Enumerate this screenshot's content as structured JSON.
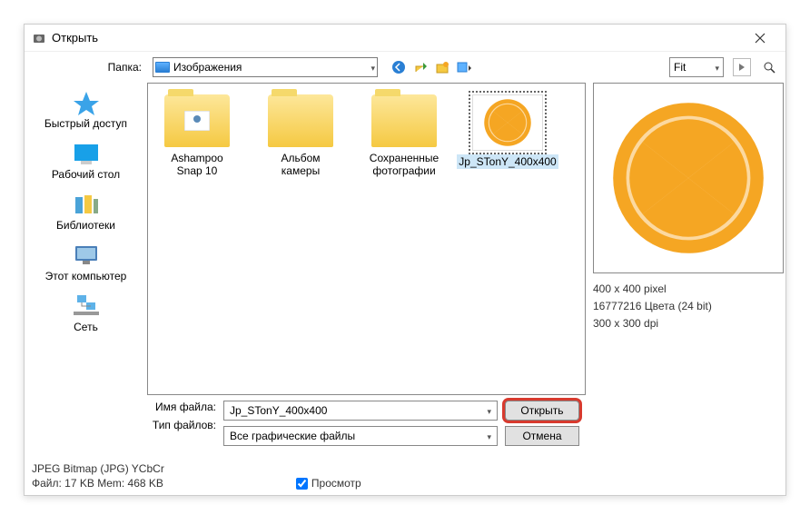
{
  "title": "Открыть",
  "folder_label": "Папка:",
  "folder_value": "Изображения",
  "fit": "Fit",
  "sidebar": {
    "items": [
      {
        "label": "Быстрый доступ"
      },
      {
        "label": "Рабочий стол"
      },
      {
        "label": "Библиотеки"
      },
      {
        "label": "Этот компьютер"
      },
      {
        "label": "Сеть"
      }
    ]
  },
  "files": [
    {
      "name": "Ashampoo Snap 10"
    },
    {
      "name": "Альбом камеры"
    },
    {
      "name": "Сохраненные фотографии"
    },
    {
      "name": "Jp_STonY_400x400"
    }
  ],
  "preview": {
    "dims": "400 x 400 pixel",
    "colors": "16777216 Цвета (24 bit)",
    "dpi": "300 x 300 dpi"
  },
  "filename_label": "Имя файла:",
  "filename_value": "Jp_STonY_400x400",
  "filetype_label": "Тип файлов:",
  "filetype_value": "Все графические файлы",
  "open_btn": "Открыть",
  "cancel_btn": "Отмена",
  "status_format": "JPEG Bitmap (JPG) YCbCr",
  "status_size": "Файл: 17 KB   Mem: 468 KB",
  "preview_check": "Просмотр"
}
